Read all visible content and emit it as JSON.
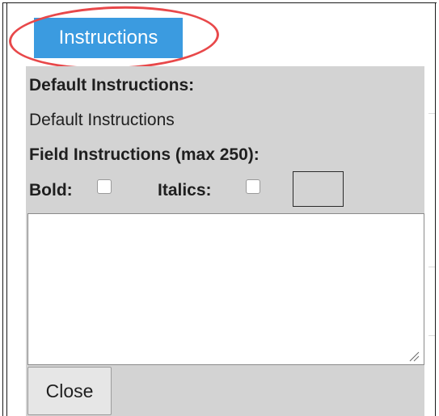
{
  "tab": {
    "label": "Instructions"
  },
  "panel": {
    "default_instructions_label": "Default Instructions:",
    "default_instructions_value": "Default Instructions",
    "field_instructions_label": "Field Instructions (max 250):",
    "bold_label": "Bold:",
    "italics_label": "Italics:",
    "field_instructions_value": "",
    "close_label": "Close"
  },
  "colors": {
    "tab_background": "#3b9be0",
    "panel_background": "#d3d3d3",
    "highlight_oval": "#e8484a"
  }
}
